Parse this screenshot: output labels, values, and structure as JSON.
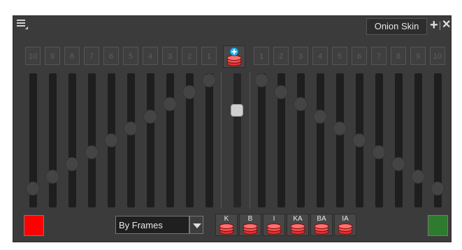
{
  "header": {
    "tab_label": "Onion Skin",
    "icons": [
      "hamburger-menu-icon",
      "add-icon",
      "close-icon"
    ]
  },
  "markers": {
    "left_labels": [
      "10",
      "9",
      "8",
      "7",
      "6",
      "5",
      "4",
      "3",
      "2",
      "1"
    ],
    "right_labels": [
      "1",
      "2",
      "3",
      "4",
      "5",
      "6",
      "7",
      "8",
      "9",
      "10"
    ],
    "center_icon": "add-onion-skin-icon"
  },
  "sliders": {
    "left_levels": [
      0.1,
      0.2,
      0.3,
      0.4,
      0.5,
      0.6,
      0.7,
      0.8,
      0.9,
      1.0
    ],
    "right_levels": [
      1.0,
      0.9,
      0.8,
      0.7,
      0.6,
      0.5,
      0.4,
      0.3,
      0.2,
      0.1
    ],
    "center_level": 0.75
  },
  "footer": {
    "previous_color": "#ff0000",
    "next_color": "#2e7a2e",
    "mode_select_value": "By Frames",
    "drawing_type_buttons": [
      {
        "label": "K",
        "name": "key-drawings-button"
      },
      {
        "label": "B",
        "name": "breakdown-drawings-button"
      },
      {
        "label": "I",
        "name": "inbetween-drawings-button"
      },
      {
        "label": "KA",
        "name": "key-animation-button"
      },
      {
        "label": "BA",
        "name": "breakdown-animation-button"
      },
      {
        "label": "IA",
        "name": "inbetween-animation-button"
      }
    ]
  }
}
